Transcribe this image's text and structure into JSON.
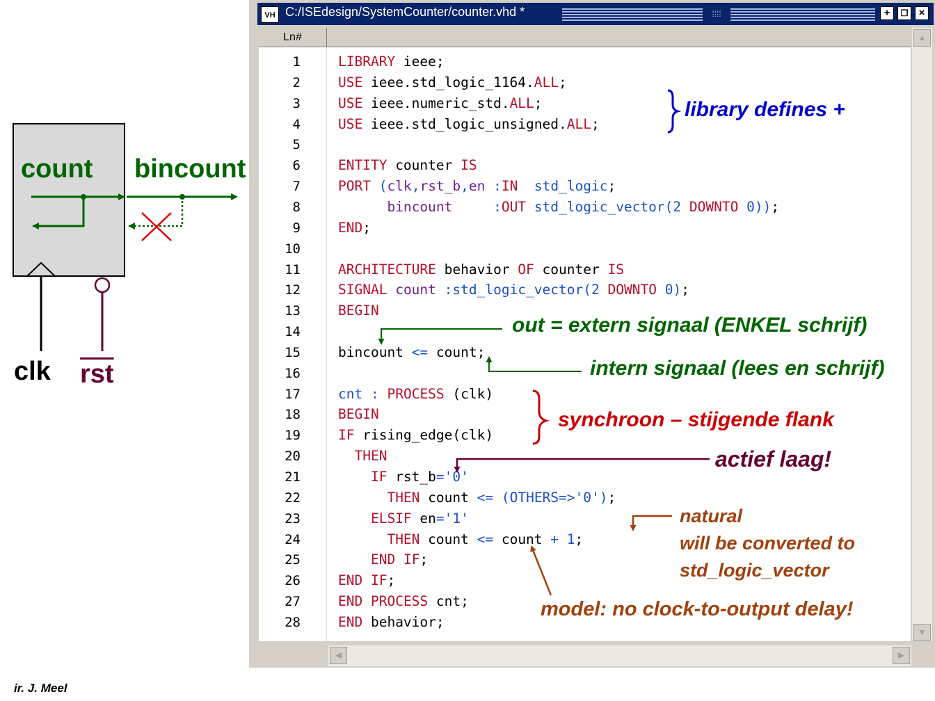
{
  "diagram": {
    "count_label": "count",
    "bincount_label": "bincount",
    "clk_label": "clk",
    "rst_label": "rst"
  },
  "credit": "ir. J. Meel",
  "window": {
    "icon_label": "VH",
    "title": "C:/ISEdesign/SystemCounter/counter.vhd *",
    "column_header": "Ln#"
  },
  "code_lines": [
    {
      "n": "1",
      "parts": [
        [
          "kw",
          "LIBRARY"
        ],
        [
          "t",
          " ieee;"
        ]
      ]
    },
    {
      "n": "2",
      "parts": [
        [
          "kw",
          "USE"
        ],
        [
          "t",
          " ieee.std_logic_1164."
        ],
        [
          "kw",
          "ALL"
        ],
        [
          "t",
          ";"
        ]
      ]
    },
    {
      "n": "3",
      "parts": [
        [
          "kw",
          "USE"
        ],
        [
          "t",
          " ieee.numeric_std."
        ],
        [
          "kw",
          "ALL"
        ],
        [
          "t",
          ";"
        ]
      ]
    },
    {
      "n": "4",
      "parts": [
        [
          "kw",
          "USE"
        ],
        [
          "t",
          " ieee.std_logic_unsigned."
        ],
        [
          "kw",
          "ALL"
        ],
        [
          "t",
          ";"
        ]
      ]
    },
    {
      "n": "5",
      "parts": []
    },
    {
      "n": "6",
      "parts": [
        [
          "kw",
          "ENTITY"
        ],
        [
          "t",
          " counter "
        ],
        [
          "kw",
          "IS"
        ]
      ]
    },
    {
      "n": "7",
      "parts": [
        [
          "kw",
          "PORT"
        ],
        [
          "t",
          " "
        ],
        [
          "op",
          "("
        ],
        [
          "id",
          "clk"
        ],
        [
          "op",
          ","
        ],
        [
          "id",
          "rst_b"
        ],
        [
          "op",
          ","
        ],
        [
          "id",
          "en"
        ],
        [
          "t",
          " "
        ],
        [
          "op",
          ":"
        ],
        [
          "kw",
          "IN"
        ],
        [
          "t",
          "  "
        ],
        [
          "ty",
          "std_logic"
        ],
        [
          "t",
          ";"
        ]
      ]
    },
    {
      "n": "8",
      "parts": [
        [
          "t",
          "      "
        ],
        [
          "id",
          "bincount"
        ],
        [
          "t",
          "     "
        ],
        [
          "op",
          ":"
        ],
        [
          "kw",
          "OUT"
        ],
        [
          "t",
          " "
        ],
        [
          "ty",
          "std_logic_vector"
        ],
        [
          "op",
          "("
        ],
        [
          "lt",
          "2"
        ],
        [
          "t",
          " "
        ],
        [
          "kw",
          "DOWNTO"
        ],
        [
          "t",
          " "
        ],
        [
          "lt",
          "0"
        ],
        [
          "op",
          "))"
        ],
        [
          "t",
          ";"
        ]
      ]
    },
    {
      "n": "9",
      "parts": [
        [
          "kw",
          "END"
        ],
        [
          "t",
          ";"
        ]
      ]
    },
    {
      "n": "10",
      "parts": []
    },
    {
      "n": "11",
      "parts": [
        [
          "kw",
          "ARCHITECTURE"
        ],
        [
          "t",
          " behavior "
        ],
        [
          "kw",
          "OF"
        ],
        [
          "t",
          " counter "
        ],
        [
          "kw",
          "IS"
        ]
      ]
    },
    {
      "n": "12",
      "parts": [
        [
          "kw",
          "SIGNAL"
        ],
        [
          "t",
          " "
        ],
        [
          "id",
          "count"
        ],
        [
          "t",
          " "
        ],
        [
          "op",
          ":"
        ],
        [
          "ty",
          "std_logic_vector"
        ],
        [
          "op",
          "("
        ],
        [
          "lt",
          "2"
        ],
        [
          "t",
          " "
        ],
        [
          "kw",
          "DOWNTO"
        ],
        [
          "t",
          " "
        ],
        [
          "lt",
          "0"
        ],
        [
          "op",
          ")"
        ],
        [
          "t",
          ";"
        ]
      ]
    },
    {
      "n": "13",
      "parts": [
        [
          "kw",
          "BEGIN"
        ]
      ]
    },
    {
      "n": "14",
      "parts": []
    },
    {
      "n": "15",
      "parts": [
        [
          "t",
          "bincount "
        ],
        [
          "op",
          "<="
        ],
        [
          "t",
          " count;"
        ]
      ]
    },
    {
      "n": "16",
      "parts": []
    },
    {
      "n": "17",
      "parts": [
        [
          "ty",
          "cnt"
        ],
        [
          "t",
          " "
        ],
        [
          "op",
          ":"
        ],
        [
          "t",
          " "
        ],
        [
          "kw",
          "PROCESS"
        ],
        [
          "t",
          " (clk)"
        ]
      ]
    },
    {
      "n": "18",
      "parts": [
        [
          "kw",
          "BEGIN"
        ]
      ]
    },
    {
      "n": "19",
      "parts": [
        [
          "kw",
          "IF"
        ],
        [
          "t",
          " rising_edge(clk)"
        ]
      ]
    },
    {
      "n": "20",
      "parts": [
        [
          "t",
          "  "
        ],
        [
          "kw",
          "THEN"
        ]
      ]
    },
    {
      "n": "21",
      "parts": [
        [
          "t",
          "    "
        ],
        [
          "kw",
          "IF"
        ],
        [
          "t",
          " rst_b"
        ],
        [
          "op",
          "="
        ],
        [
          "lt",
          "'0'"
        ]
      ]
    },
    {
      "n": "22",
      "parts": [
        [
          "t",
          "      "
        ],
        [
          "kw",
          "THEN"
        ],
        [
          "t",
          " count "
        ],
        [
          "op",
          "<="
        ],
        [
          "t",
          " "
        ],
        [
          "op",
          "("
        ],
        [
          "ty",
          "OTHERS"
        ],
        [
          "op",
          "=>"
        ],
        [
          "lt",
          "'0'"
        ],
        [
          "op",
          ")"
        ],
        [
          "t",
          ";"
        ]
      ]
    },
    {
      "n": "23",
      "parts": [
        [
          "t",
          "    "
        ],
        [
          "kw",
          "ELSIF"
        ],
        [
          "t",
          " en"
        ],
        [
          "op",
          "="
        ],
        [
          "lt",
          "'1'"
        ]
      ]
    },
    {
      "n": "24",
      "parts": [
        [
          "t",
          "      "
        ],
        [
          "kw",
          "THEN"
        ],
        [
          "t",
          " count "
        ],
        [
          "op",
          "<="
        ],
        [
          "t",
          " count "
        ],
        [
          "op",
          "+"
        ],
        [
          "t",
          " "
        ],
        [
          "lt",
          "1"
        ],
        [
          "t",
          ";"
        ]
      ]
    },
    {
      "n": "25",
      "parts": [
        [
          "t",
          "    "
        ],
        [
          "kw",
          "END"
        ],
        [
          "t",
          " "
        ],
        [
          "kw",
          "IF"
        ],
        [
          "t",
          ";"
        ]
      ]
    },
    {
      "n": "26",
      "parts": [
        [
          "kw",
          "END"
        ],
        [
          "t",
          " "
        ],
        [
          "kw",
          "IF"
        ],
        [
          "t",
          ";"
        ]
      ]
    },
    {
      "n": "27",
      "parts": [
        [
          "kw",
          "END"
        ],
        [
          "t",
          " "
        ],
        [
          "kw",
          "PROCESS"
        ],
        [
          "t",
          " cnt;"
        ]
      ]
    },
    {
      "n": "28",
      "parts": [
        [
          "kw",
          "END"
        ],
        [
          "t",
          " behavior;"
        ]
      ]
    }
  ],
  "annotations": {
    "library": "library defines +",
    "out_signal": "out = extern signaal (ENKEL schrijf)",
    "intern_signal": "intern signaal (lees en schrijf)",
    "synchroon": "synchroon – stijgende flank",
    "actief": "actief laag!",
    "natural": "natural",
    "converted": "will be converted to",
    "slv": "std_logic_vector",
    "model": "model: no clock-to-output delay!"
  },
  "colors": {
    "keyword": "#b3122b",
    "type": "#1a50c8",
    "identifier": "#6e1f8f",
    "titlebar": "#0a246a"
  }
}
